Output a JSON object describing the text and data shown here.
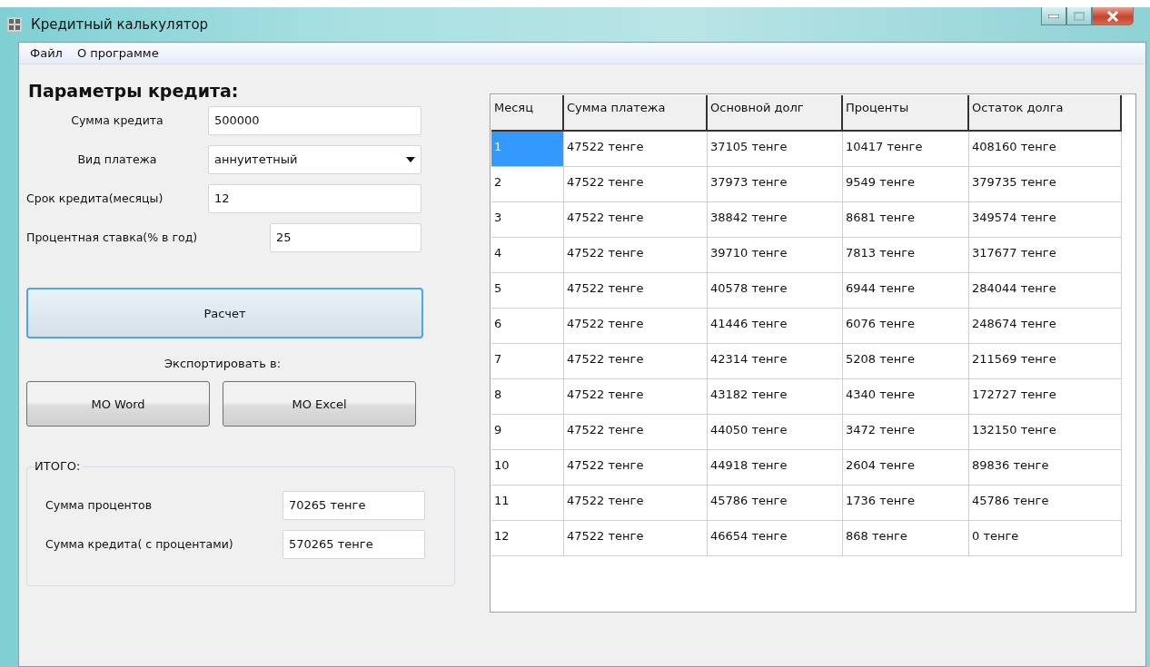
{
  "window": {
    "title": "Кредитный калькулятор"
  },
  "menu": [
    {
      "label": "Файл"
    },
    {
      "label": "О программе"
    }
  ],
  "parameters": {
    "heading": "Параметры кредита:",
    "fields": [
      {
        "kind": "text",
        "label": "Сумма кредита",
        "value": "500000"
      },
      {
        "kind": "select",
        "label": "Вид платежа",
        "value": "аннуитетный"
      },
      {
        "kind": "text",
        "label": "Срок кредита(месяцы)",
        "value": "12"
      },
      {
        "kind": "text",
        "label": "Процентная ставка(% в год)",
        "value": "25"
      }
    ]
  },
  "calculate_button": "Расчет",
  "export": {
    "label": "Экспортировать в:",
    "buttons": [
      "MO Word",
      "MO Excel"
    ]
  },
  "totals": {
    "title": "ИТОГО:",
    "fields": [
      {
        "label": "Сумма процентов",
        "value": "70265  тенге"
      },
      {
        "label": "Сумма кредита( с процентами)",
        "value": "570265  тенге"
      }
    ]
  },
  "table": {
    "columns": [
      "Месяц",
      "Сумма платежа",
      "Основной долг",
      "Проценты",
      "Остаток долга"
    ],
    "rows": [
      {
        "selected": true,
        "cells": [
          "1",
          "47522  тенге",
          "37105  тенге",
          "10417  тенге",
          "408160  тенге"
        ]
      },
      {
        "selected": false,
        "cells": [
          "2",
          "47522  тенге",
          "37973  тенге",
          "9549  тенге",
          "379735  тенге"
        ]
      },
      {
        "selected": false,
        "cells": [
          "3",
          "47522  тенге",
          "38842  тенге",
          "8681  тенге",
          "349574  тенге"
        ]
      },
      {
        "selected": false,
        "cells": [
          "4",
          "47522  тенге",
          "39710  тенге",
          "7813  тенге",
          "317677  тенге"
        ]
      },
      {
        "selected": false,
        "cells": [
          "5",
          "47522  тенге",
          "40578  тенге",
          "6944  тенге",
          "284044  тенге"
        ]
      },
      {
        "selected": false,
        "cells": [
          "6",
          "47522  тенге",
          "41446  тенге",
          "6076  тенге",
          "248674  тенге"
        ]
      },
      {
        "selected": false,
        "cells": [
          "7",
          "47522  тенге",
          "42314  тенге",
          "5208  тенге",
          "211569  тенге"
        ]
      },
      {
        "selected": false,
        "cells": [
          "8",
          "47522  тенге",
          "43182  тенге",
          "4340  тенге",
          "172727  тенге"
        ]
      },
      {
        "selected": false,
        "cells": [
          "9",
          "47522  тенге",
          "44050  тенге",
          "3472  тенге",
          "132150  тенге"
        ]
      },
      {
        "selected": false,
        "cells": [
          "10",
          "47522  тенге",
          "44918  тенге",
          "2604  тенге",
          "89836  тенге"
        ]
      },
      {
        "selected": false,
        "cells": [
          "11",
          "47522  тенге",
          "45786  тенге",
          "1736  тенге",
          "45786  тенге"
        ]
      },
      {
        "selected": false,
        "cells": [
          "12",
          "47522  тенге",
          "46654  тенге",
          "868  тенге",
          "0  тенге"
        ]
      }
    ]
  }
}
